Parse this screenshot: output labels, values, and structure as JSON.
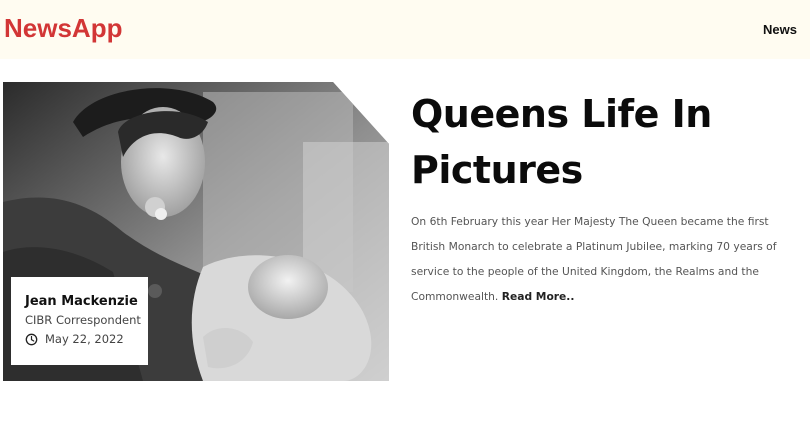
{
  "header": {
    "brand": "NewsApp",
    "nav": {
      "news_label": "News"
    }
  },
  "article": {
    "image_alt": "Black and white photo of a young Queen holding a baby",
    "author": {
      "name": "Jean Mackenzie",
      "role": "CIBR Correspondent",
      "date": "May 22, 2022",
      "date_icon": "clock-icon"
    },
    "title": "Queens Life In Pictures",
    "summary": "On 6th February this year Her Majesty The Queen became the first British Monarch to celebrate a Platinum Jubilee, marking 70 years of service to the people of the United Kingdom, the Realms and the Commonwealth.",
    "read_more_label": "Read More.."
  },
  "colors": {
    "brand": "#d23636",
    "header_bg": "#fffcf1",
    "headline": "#0b0b0b",
    "body_text": "#555555"
  }
}
